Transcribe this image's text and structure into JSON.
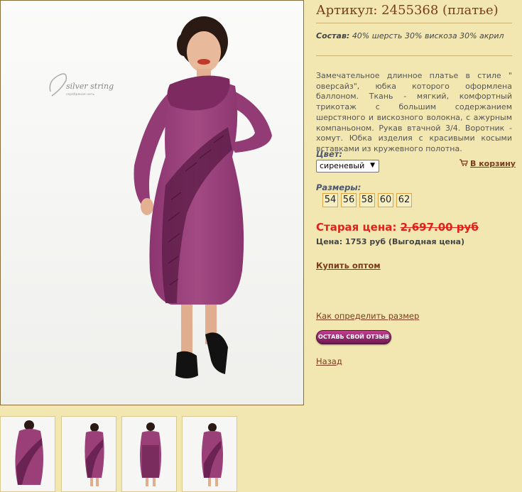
{
  "product": {
    "title": "Артикул: 2455368 (платье)",
    "composition_label": "Состав:",
    "composition_value": "40% шерсть 30% вискоза 30% акрил",
    "description": "Замечательное длинное платье в стиле \" оверсайз\", юбка которого оформлена баллоном. Ткань - мягкий, комфортный трикотаж с большим содержанием шерстяного и вискозного волокна, с ажурным компаньоном. Рукав втачной 3/4. Воротник - хомут. Юбка изделия с красивыми косыми вставками из кружевного полотна."
  },
  "brand": {
    "logo_text": "silver string",
    "logo_subtext": "серебряная нить"
  },
  "color": {
    "label": "Цвет:",
    "selected": "сиреневый"
  },
  "cart": {
    "label": "В корзину",
    "icon": "cart-icon"
  },
  "sizes": {
    "label": "Размеры:",
    "items": [
      "54",
      "56",
      "58",
      "60",
      "62"
    ]
  },
  "pricing": {
    "old_label": "Старая цена:",
    "old_value": "2,697.00 руб",
    "current": "Цена: 1753 руб (Выгодная цена)"
  },
  "links": {
    "wholesale": "Купить оптом",
    "size_help": "Как определить размер",
    "review": "ОСТАВЬ СВОЙ ОТЗЫВ",
    "back": "Назад"
  },
  "colors": {
    "background": "#f3e7b1",
    "link": "#7a3b1c",
    "old_price": "#e0231a",
    "dress": "#9b3f79",
    "size_border": "#e3a240"
  }
}
